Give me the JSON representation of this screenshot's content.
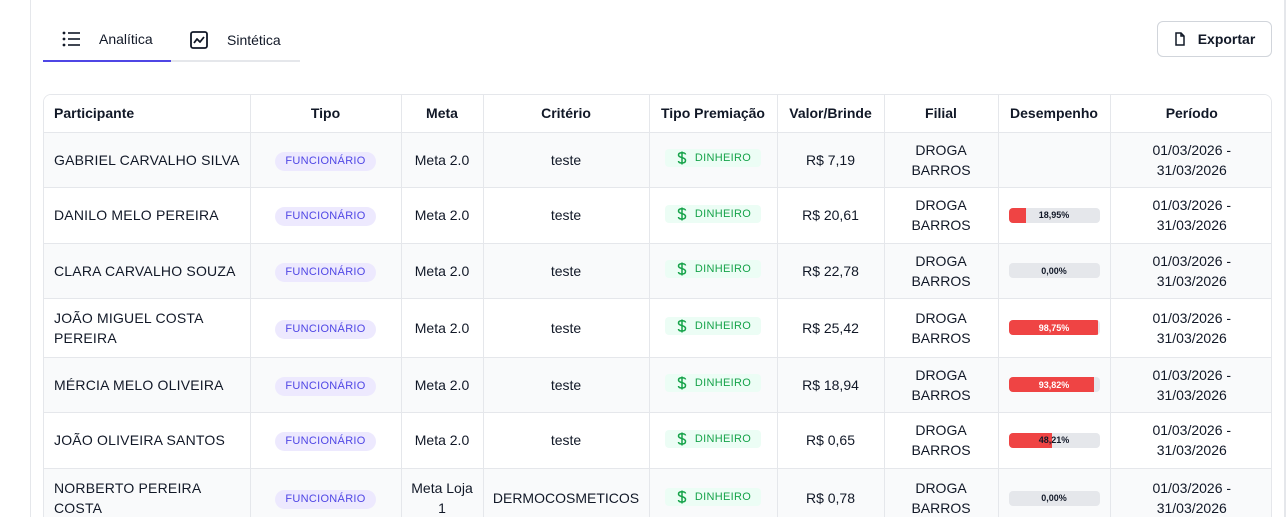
{
  "tabs": [
    {
      "label": "Analítica",
      "icon": "list-icon",
      "active": true
    },
    {
      "label": "Sintética",
      "icon": "chart-icon",
      "active": false
    }
  ],
  "export_label": "Exportar",
  "table": {
    "headers": [
      "Participante",
      "Tipo",
      "Meta",
      "Critério",
      "Tipo Premiação",
      "Valor/Brinde",
      "Filial",
      "Desempenho",
      "Período"
    ],
    "rows": [
      {
        "name": "GABRIEL CARVALHO SILVA",
        "tipo": "FUNCIONÁRIO",
        "meta": "Meta 2.0",
        "criterio": "teste",
        "premiacao": "DINHEIRO",
        "valor": "R$ 7,19",
        "filial": "DROGA BARROS",
        "desempenho": null,
        "desempenho_label": "",
        "periodo": "01/03/2026 - 31/03/2026"
      },
      {
        "name": "DANILO MELO PEREIRA",
        "tipo": "FUNCIONÁRIO",
        "meta": "Meta 2.0",
        "criterio": "teste",
        "premiacao": "DINHEIRO",
        "valor": "R$ 20,61",
        "filial": "DROGA BARROS",
        "desempenho": 18.95,
        "desempenho_label": "18,95%",
        "periodo": "01/03/2026 - 31/03/2026"
      },
      {
        "name": "CLARA CARVALHO SOUZA",
        "tipo": "FUNCIONÁRIO",
        "meta": "Meta 2.0",
        "criterio": "teste",
        "premiacao": "DINHEIRO",
        "valor": "R$ 22,78",
        "filial": "DROGA BARROS",
        "desempenho": 0,
        "desempenho_label": "0,00%",
        "periodo": "01/03/2026 - 31/03/2026"
      },
      {
        "name": "JOÃO MIGUEL COSTA PEREIRA",
        "tipo": "FUNCIONÁRIO",
        "meta": "Meta 2.0",
        "criterio": "teste",
        "premiacao": "DINHEIRO",
        "valor": "R$ 25,42",
        "filial": "DROGA BARROS",
        "desempenho": 98.75,
        "desempenho_label": "98,75%",
        "periodo": "01/03/2026 - 31/03/2026"
      },
      {
        "name": "MÉRCIA MELO OLIVEIRA",
        "tipo": "FUNCIONÁRIO",
        "meta": "Meta 2.0",
        "criterio": "teste",
        "premiacao": "DINHEIRO",
        "valor": "R$ 18,94",
        "filial": "DROGA BARROS",
        "desempenho": 93.82,
        "desempenho_label": "93,82%",
        "periodo": "01/03/2026 - 31/03/2026"
      },
      {
        "name": "JOÃO OLIVEIRA SANTOS",
        "tipo": "FUNCIONÁRIO",
        "meta": "Meta 2.0",
        "criterio": "teste",
        "premiacao": "DINHEIRO",
        "valor": "R$ 0,65",
        "filial": "DROGA BARROS",
        "desempenho": 48.21,
        "desempenho_label": "48,21%",
        "periodo": "01/03/2026 - 31/03/2026"
      },
      {
        "name": "NORBERTO PEREIRA COSTA",
        "tipo": "FUNCIONÁRIO",
        "meta": "Meta Loja 1",
        "criterio": "DERMOCOSMETICOS",
        "premiacao": "DINHEIRO",
        "valor": "R$ 0,78",
        "filial": "DROGA BARROS",
        "desempenho": 0,
        "desempenho_label": "0,00%",
        "periodo": "01/03/2026 - 31/03/2026"
      }
    ]
  },
  "colors": {
    "accent": "#4f46e5",
    "badge_funcionario_bg": "#ede9fe",
    "badge_dinheiro_text": "#16a34a",
    "badge_dinheiro_bg": "#ecfdf5",
    "performance_fill": "#ef4444"
  }
}
